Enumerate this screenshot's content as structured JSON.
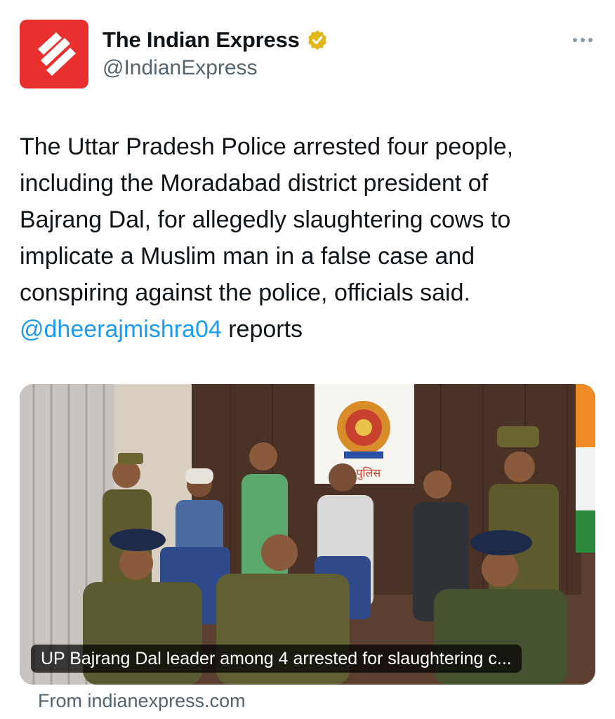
{
  "account": {
    "display_name": "The Indian Express",
    "handle": "@IndianExpress",
    "verified": true,
    "avatar_icon": "indian-express-logo",
    "brand_color": "#e8312f"
  },
  "tweet": {
    "text": "The Uttar Pradesh Police arrested four people,\nincluding the Moradabad district president of\nBajrang Dal, for allegedly slaughtering cows to\nimplicate a Muslim man in a false case and\nconspiring against the police, officials said.\n",
    "mention": "@dheerajmishra04",
    "text_suffix": " reports"
  },
  "card": {
    "caption": "UP Bajrang Dal leader among 4 arrested for slaughtering c...",
    "source": "From indianexpress.com",
    "emblem_text": "द पुलिस"
  },
  "colors": {
    "link": "#1d9bf0",
    "secondary_text": "#536471",
    "verified_badge": "#e2b719"
  }
}
